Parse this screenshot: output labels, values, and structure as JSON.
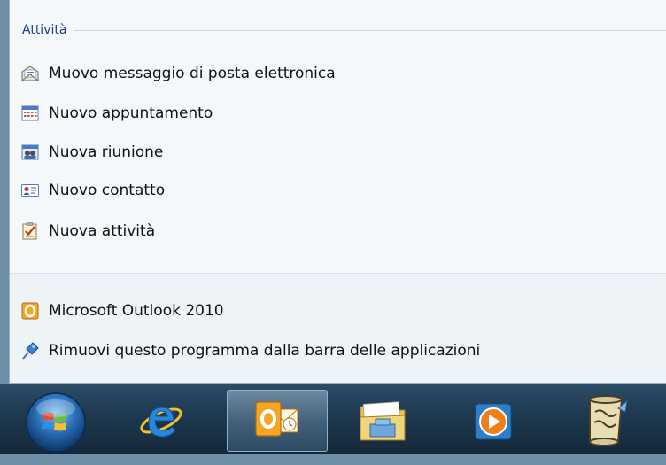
{
  "jumplist": {
    "section_title": "Attività",
    "tasks": [
      {
        "label": "Muovo messaggio di posta elettronica",
        "icon": "new-email-icon"
      },
      {
        "label": "Nuovo appuntamento",
        "icon": "calendar-icon"
      },
      {
        "label": "Nuova riunione",
        "icon": "meeting-icon"
      },
      {
        "label": "Nuovo contatto",
        "icon": "contact-card-icon"
      },
      {
        "label": "Nuova attività",
        "icon": "task-icon"
      }
    ],
    "program": {
      "label": "Microsoft Outlook 2010",
      "icon": "outlook-icon"
    },
    "unpin": {
      "label": "Rimuovi questo programma dalla barra delle applicazioni",
      "icon": "unpin-icon"
    }
  },
  "taskbar": {
    "buttons": [
      {
        "name": "start-button",
        "icon": "windows-orb-icon"
      },
      {
        "name": "internet-explorer",
        "icon": "ie-icon"
      },
      {
        "name": "outlook",
        "icon": "outlook-icon",
        "active": true
      },
      {
        "name": "explorer",
        "icon": "folder-icon"
      },
      {
        "name": "media-player",
        "icon": "media-player-icon"
      },
      {
        "name": "scroll-app",
        "icon": "scroll-icon"
      }
    ]
  },
  "colors": {
    "section_title": "#1e3b8f",
    "jumplist_bg": "#f4f8fb",
    "taskbar_bg": "#1f3a52",
    "outlook_orange": "#f5a623"
  }
}
